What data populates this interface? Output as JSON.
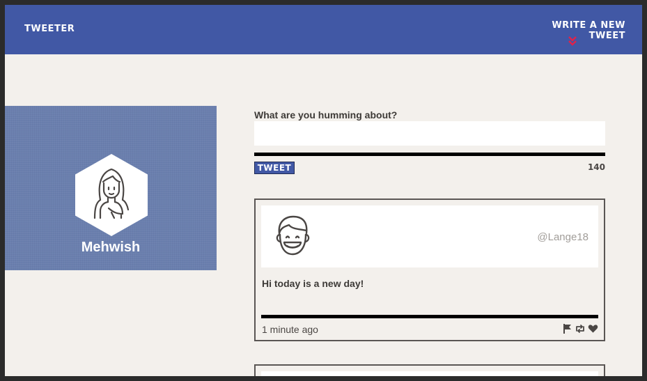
{
  "header": {
    "brand": "TWEETER",
    "write_link": "WRITE A NEW TWEET",
    "write_icon": "double-chevron-down-icon"
  },
  "profile": {
    "name": "Mehwish",
    "avatar_icon": "woman-avatar-icon"
  },
  "compose": {
    "label": "What are you humming about?",
    "input_value": "",
    "input_placeholder": "",
    "tweet_button": "TWEET",
    "char_count": "140"
  },
  "tweets": [
    {
      "handle": "@Lange18",
      "avatar_icon": "smiling-man-avatar-icon",
      "text": "Hi today is a new day!",
      "time": "1 minute ago",
      "actions": [
        "flag-icon",
        "retweet-icon",
        "heart-icon"
      ]
    }
  ],
  "colors": {
    "header_bg": "#4158a5",
    "accent_red": "#e0224a",
    "page_bg": "#f3f0ec",
    "profile_bg": "#6a7fae",
    "text_dark": "#3d3a37",
    "handle_gray": "#a19d99"
  }
}
